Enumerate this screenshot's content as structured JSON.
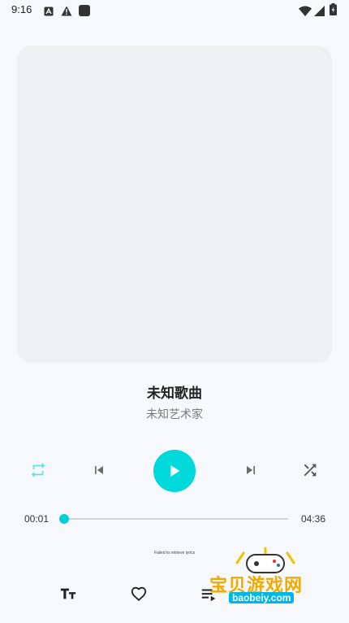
{
  "status_bar": {
    "time": "9:16",
    "icons": [
      "a-app-icon",
      "warning-icon",
      "square-app-icon",
      "wifi-icon",
      "signal-icon",
      "battery-icon"
    ]
  },
  "track": {
    "title": "未知歌曲",
    "artist": "未知艺术家"
  },
  "controls": {
    "repeat": "repeat-icon",
    "previous": "skip-previous-icon",
    "play": "play-icon",
    "next": "skip-next-icon",
    "shuffle": "shuffle-icon",
    "accent_color": "#00d9d9"
  },
  "progress": {
    "current": "00:01",
    "total": "04:36",
    "fraction": 0.004
  },
  "lyrics": {
    "message": "Failed to retrieve lyrics"
  },
  "bottom_bar": {
    "icons": [
      "text-size-icon",
      "heart-icon",
      "queue-icon"
    ]
  },
  "watermark": {
    "cn": "宝贝游戏网",
    "en": "baobeiy.com"
  }
}
